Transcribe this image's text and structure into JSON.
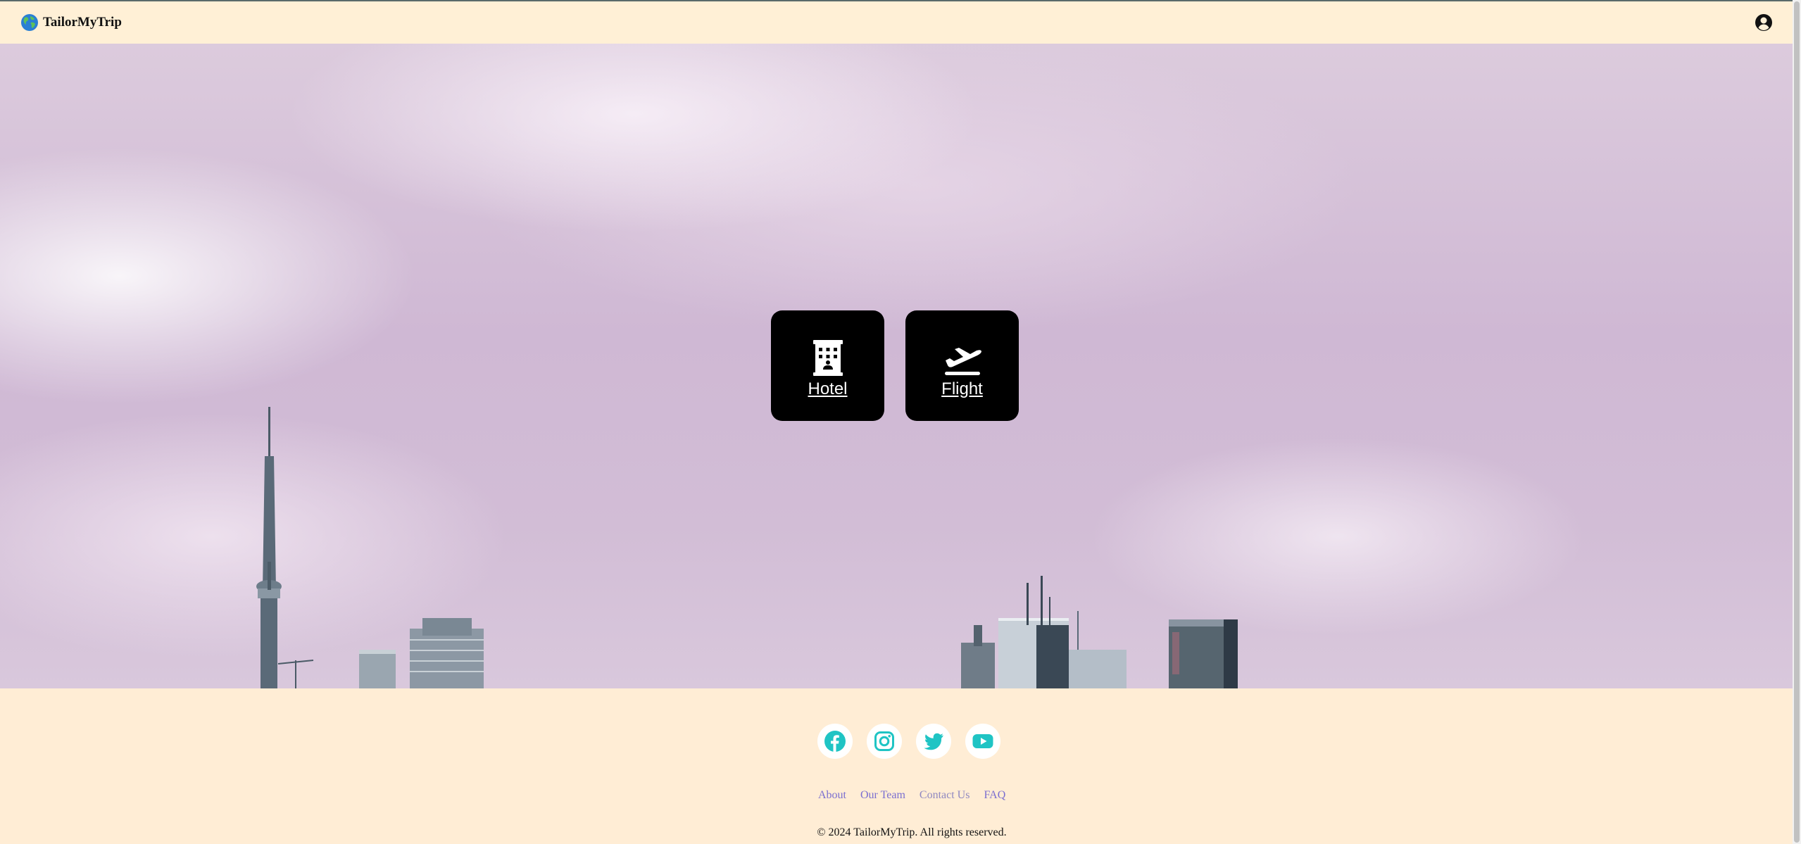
{
  "header": {
    "brand_name": "TailorMyTrip",
    "brand_icon": "globe-icon",
    "user_icon": "user-circle-icon"
  },
  "hero": {
    "cards": [
      {
        "label": "Hotel",
        "icon": "hotel-icon"
      },
      {
        "label": "Flight",
        "icon": "plane-departure-icon"
      }
    ]
  },
  "footer": {
    "socials": [
      "facebook-icon",
      "instagram-icon",
      "twitter-icon",
      "youtube-icon"
    ],
    "social_color": "#1fc4c4",
    "links": [
      "About",
      "Our Team",
      "Contact Us",
      "FAQ"
    ],
    "copyright": "© 2024 TailorMyTrip. All rights reserved."
  },
  "colors": {
    "header_bg": "#fff0d6",
    "footer_bg": "#ffedd5",
    "card_bg": "#000000",
    "link": "#7b6fd0"
  }
}
